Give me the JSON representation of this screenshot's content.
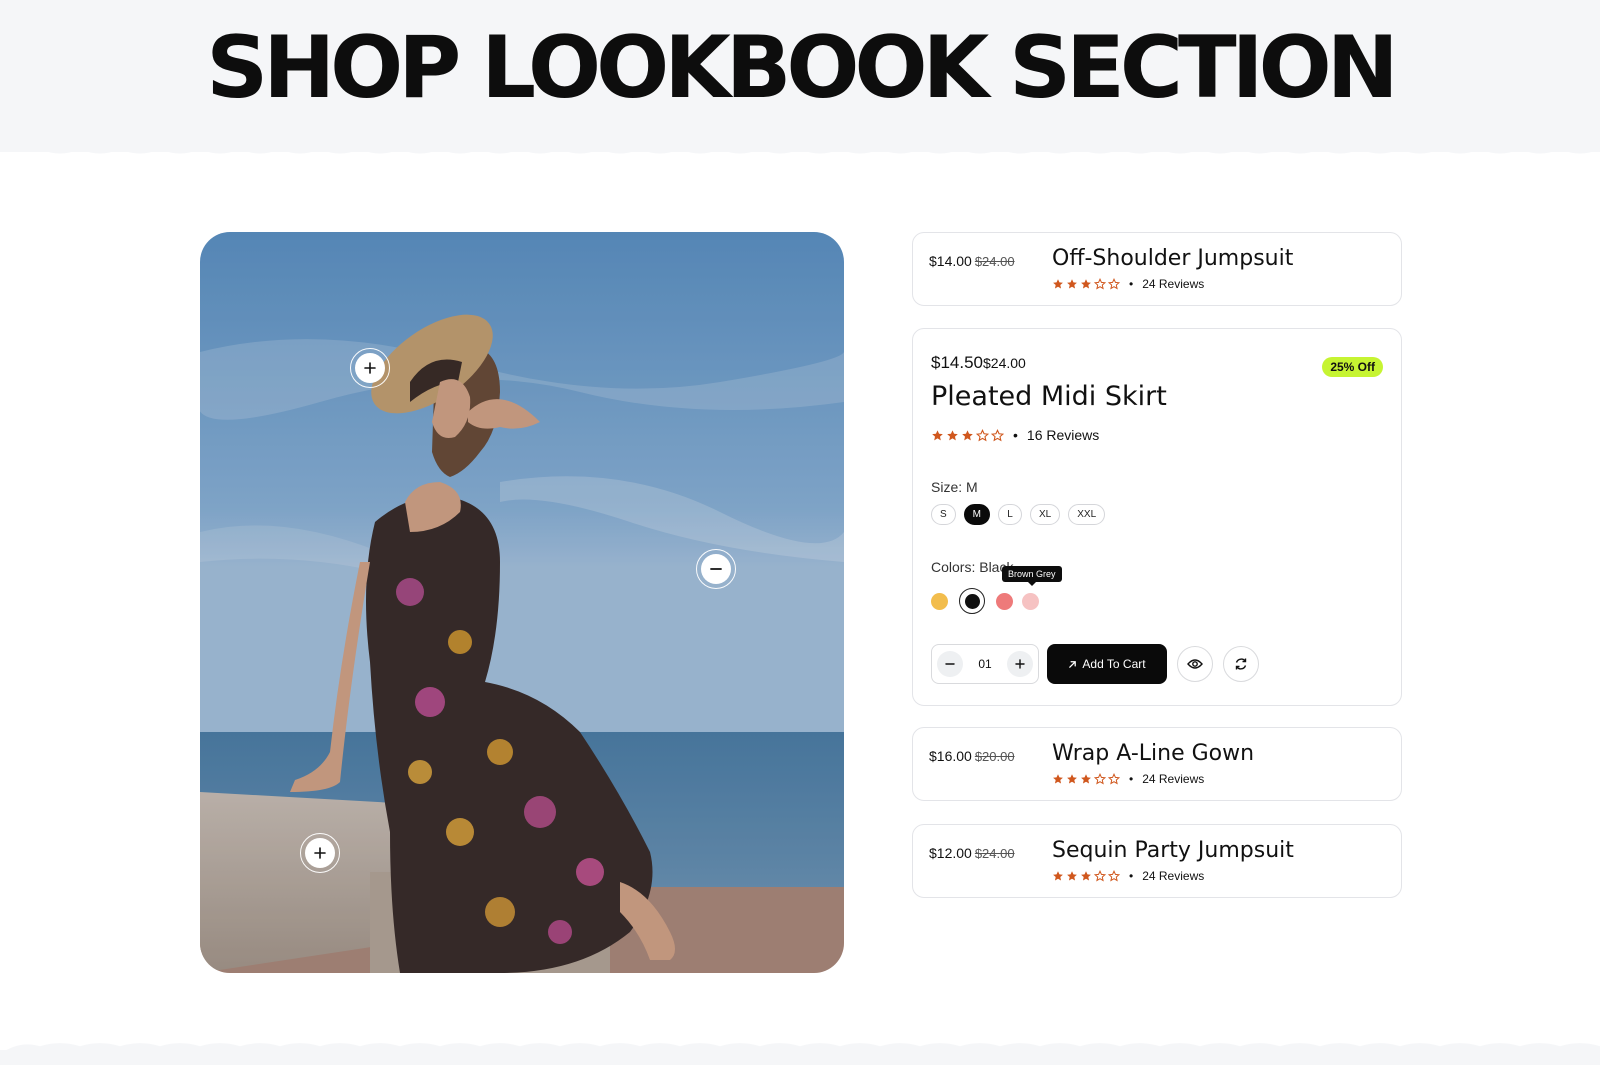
{
  "page": {
    "title": "SHOP LOOKBOOK SECTION"
  },
  "lookbook": {
    "hotspots": [
      {
        "name": "hotspot-hat",
        "icon": "plus-icon"
      },
      {
        "name": "hotspot-dress",
        "icon": "minus-icon"
      },
      {
        "name": "hotspot-bench",
        "icon": "plus-icon"
      }
    ]
  },
  "products": [
    {
      "price": "$14.00",
      "old_price": "$24.00",
      "name": "Off-Shoulder Jumpsuit",
      "rating": 3,
      "reviews": "24 Reviews"
    },
    {
      "price": "$14.50",
      "old_price": "$24.00",
      "name": "Pleated Midi Skirt",
      "rating": 3,
      "reviews": "16 Reviews",
      "badge": "25% Off",
      "size_label": "Size: M",
      "sizes": [
        "S",
        "M",
        "L",
        "XL",
        "XXL"
      ],
      "selected_size": "M",
      "colors_label": "Colors: Black",
      "colors": [
        {
          "name": "Yellow",
          "hex": "#f2bd4d"
        },
        {
          "name": "Black",
          "hex": "#111111"
        },
        {
          "name": "Coral",
          "hex": "#ee7a7a"
        },
        {
          "name": "Brown Grey",
          "hex": "#f6c2c2"
        }
      ],
      "tooltip": "Brown Grey",
      "quantity": "01",
      "add_to_cart": "Add To Cart"
    },
    {
      "price": "$16.00",
      "old_price": "$20.00",
      "name": "Wrap A-Line Gown",
      "rating": 3,
      "reviews": "24 Reviews"
    },
    {
      "price": "$12.00",
      "old_price": "$24.00",
      "name": "Sequin Party Jumpsuit",
      "rating": 3,
      "reviews": "24 Reviews"
    }
  ],
  "colors": {
    "star": "#d0571d",
    "badge": "#c6f432",
    "button": "#0a0a0a",
    "header_bg": "#f5f6f8"
  }
}
